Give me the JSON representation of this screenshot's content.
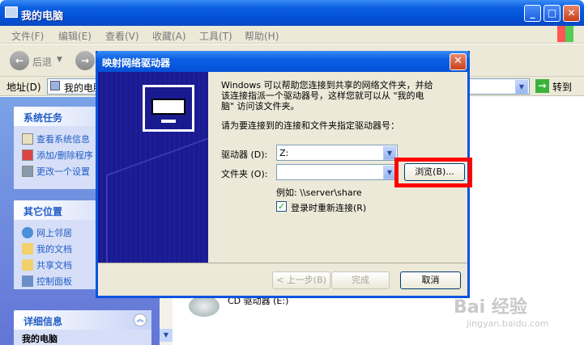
{
  "window": {
    "title": "我的电脑"
  },
  "menu": [
    "文件(F)",
    "编辑(E)",
    "查看(V)",
    "收藏(A)",
    "工具(T)",
    "帮助(H)"
  ],
  "toolbar": {
    "back": "后退"
  },
  "address": {
    "label": "地址(D)",
    "value": "我的电脑",
    "go": "转到"
  },
  "tasks": {
    "title": "系统任务",
    "items": [
      "查看系统信息",
      "添加/删除程序",
      "更改一个设置"
    ]
  },
  "places": {
    "title": "其它位置",
    "items": [
      "网上邻居",
      "我的文档",
      "共享文档",
      "控制面板"
    ]
  },
  "details": {
    "title": "详细信息",
    "first": "我的电脑"
  },
  "main": {
    "cd_label": "CD 驱动器 (E:)"
  },
  "dialog": {
    "title": "映射网络驱动器",
    "intro": [
      "Windows 可以帮助您连接到共享的网络文件夹，并给",
      "该连接指派一个驱动器号，这样您就可以从 \"我的电",
      "脑\" 访问该文件夹。"
    ],
    "prompt": "请为要连接到的连接和文件夹指定驱动器号：",
    "drive_label": "驱动器 (D):",
    "drive_value": "Z:",
    "folder_label": "文件夹 (O):",
    "folder_value": "",
    "browse": "浏览(B)...",
    "example": "例如: \\\\server\\share",
    "reconnect": "登录时重新连接(R)",
    "back": "< 上一步(B)",
    "finish": "完成",
    "cancel": "取消"
  },
  "watermark": {
    "text": "Bai 经验",
    "url": "jingyan.baidu.com"
  }
}
